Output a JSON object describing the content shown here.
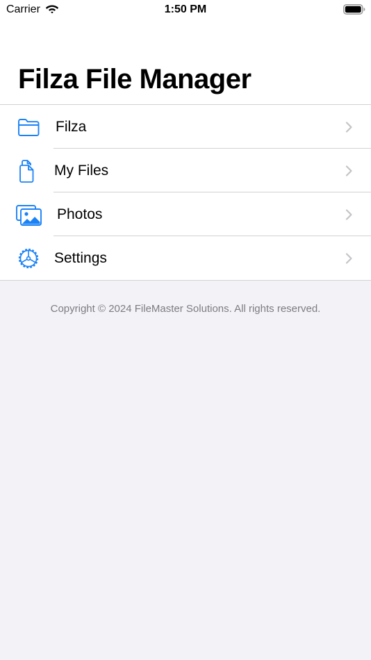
{
  "status_bar": {
    "carrier": "Carrier",
    "time": "1:50 PM"
  },
  "header": {
    "title": "Filza File Manager"
  },
  "menu": {
    "items": [
      {
        "label": "Filza",
        "icon": "folder-icon"
      },
      {
        "label": "My Files",
        "icon": "documents-icon"
      },
      {
        "label": "Photos",
        "icon": "photos-icon"
      },
      {
        "label": "Settings",
        "icon": "gear-icon"
      }
    ]
  },
  "footer": {
    "copyright": "Copyright © 2024 FileMaster Solutions. All rights reserved."
  },
  "colors": {
    "accent": "#1a82f5",
    "background": "#f2f2f7",
    "separator": "#d1d1d6",
    "chevron": "#c4c4c7"
  }
}
